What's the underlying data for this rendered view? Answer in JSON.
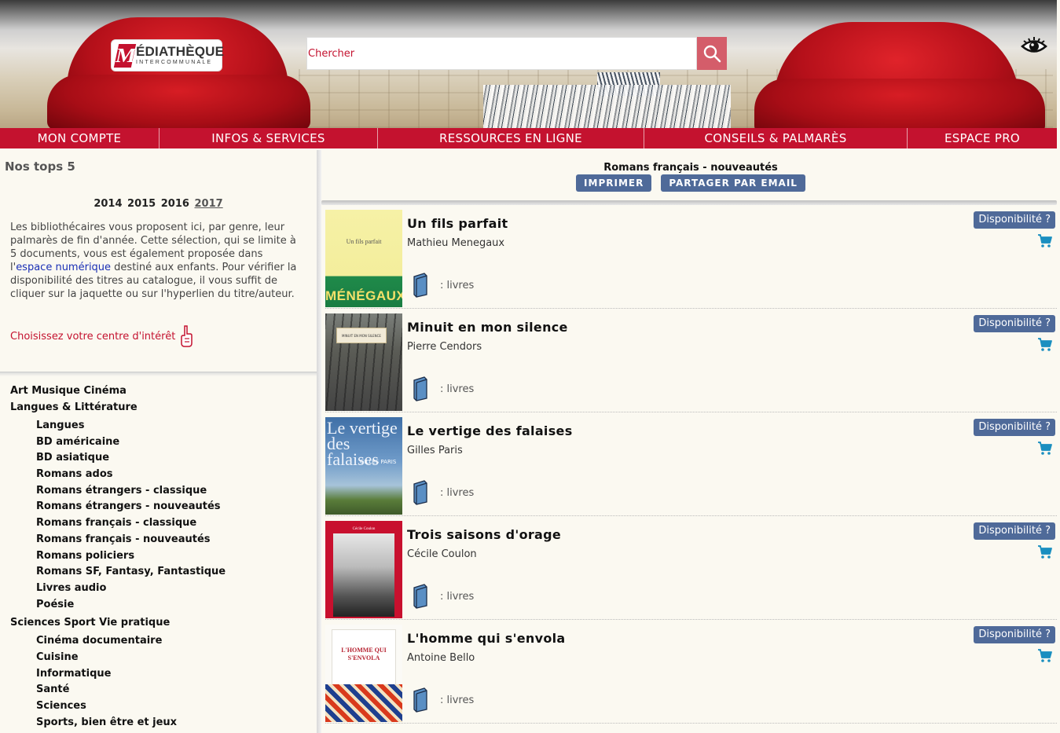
{
  "header": {
    "logo_title": "ÉDIATHÈQUE",
    "logo_letter": "M",
    "logo_subtitle": "INTERCOMMUNALE",
    "search_placeholder": "Chercher"
  },
  "nav": [
    "MON COMPTE",
    "INFOS & SERVICES",
    "RESSOURCES EN LIGNE",
    "CONSEILS & PALMARÈS",
    "ESPACE PRO"
  ],
  "left": {
    "title": "Nos tops 5",
    "years": [
      "2014",
      "2015",
      "2016",
      "2017"
    ],
    "active_year": "2017",
    "intro_before": "Les bibliothécaires vous proposent ici, par genre, leur palmarès de fin d'année. Cette sélection, qui se limite à 5 documents, vous est également proposée dans l'",
    "intro_link": "espace numérique",
    "intro_after": " destiné aux enfants. Pour vérifier la disponibilité des titres au catalogue, il vous suffit de cliquer sur la jaquette ou sur l'hyperlien du titre/auteur.",
    "choose_label": "Choisissez votre centre d'intérêt",
    "categories": [
      {
        "label": "Art Musique Cinéma",
        "sub": []
      },
      {
        "label": "Langues & Littérature",
        "sub": [
          "Langues",
          "BD américaine",
          "BD asiatique",
          "Romans ados",
          "Romans étrangers - classique",
          "Romans étrangers - nouveautés",
          "Romans français - classique",
          "Romans français - nouveautés",
          "Romans policiers",
          "Romans SF, Fantasy, Fantastique",
          "Livres audio",
          "Poésie"
        ]
      },
      {
        "label": "Sciences Sport Vie pratique",
        "sub": [
          "Cinéma documentaire",
          "Cuisine",
          "Informatique",
          "Santé",
          "Sciences",
          "Sports, bien être et jeux"
        ]
      }
    ]
  },
  "right": {
    "list_title": "Romans français - nouveautés",
    "print_label": "IMPRIMER",
    "share_label": "PARTAGER PAR EMAIL",
    "availability_label": "Disponibilité ?",
    "type_label": ": livres",
    "documents": [
      {
        "title": "Un fils parfait",
        "author": "Mathieu Menegaux",
        "cover_text": "Un fils parfait",
        "cover_author": "MÉNÉGAUX"
      },
      {
        "title": "Minuit en mon silence",
        "author": "Pierre Cendors",
        "cover_text": "MINUIT EN MON SILENCE"
      },
      {
        "title": "Le vertige des falaises",
        "author": "Gilles Paris",
        "cover_text": "Le vertige des falaises",
        "cover_author": "GILLES PARIS"
      },
      {
        "title": "Trois saisons d'orage",
        "author": "Cécile Coulon",
        "cover_text": "Cécile Coulon"
      },
      {
        "title": "L'homme qui s'envola",
        "author": "Antoine Bello",
        "cover_text": "L'HOMME QUI S'ENVOLA"
      }
    ]
  },
  "colors": {
    "brand_red": "#c4122f",
    "button_blue": "#4f6a99",
    "cart_blue": "#1a8fc0"
  }
}
